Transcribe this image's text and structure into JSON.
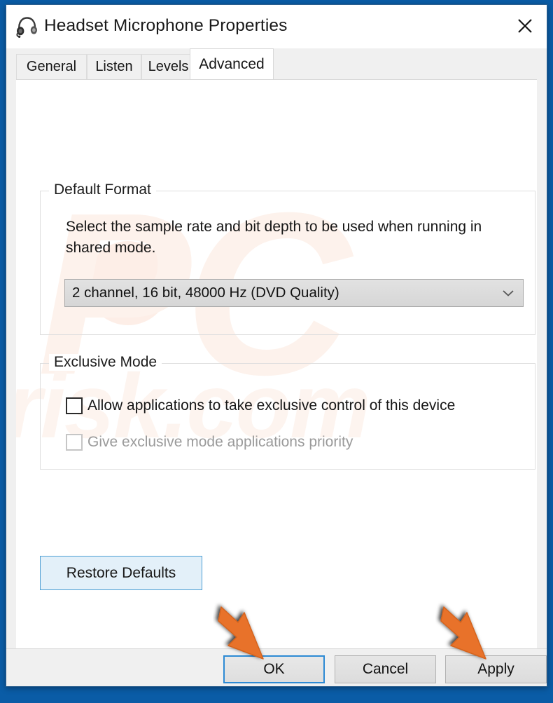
{
  "window": {
    "title": "Headset Microphone Properties",
    "icon": "headset-icon",
    "close_label": "✕"
  },
  "tabs": [
    {
      "label": "General",
      "active": false
    },
    {
      "label": "Listen",
      "active": false
    },
    {
      "label": "Levels",
      "active": false
    },
    {
      "label": "Advanced",
      "active": true
    }
  ],
  "default_format": {
    "group_title": "Default Format",
    "description": "Select the sample rate and bit depth to be used when running in shared mode.",
    "combo": {
      "value": "2 channel, 16 bit, 48000 Hz (DVD Quality)",
      "arrow_icon": "chevron-down-icon",
      "options": [
        "2 channel, 16 bit, 48000 Hz (DVD Quality)"
      ]
    }
  },
  "exclusive_mode": {
    "group_title": "Exclusive Mode",
    "checkboxes": [
      {
        "label": "Allow applications to take exclusive control of this device",
        "checked": false,
        "disabled": false
      },
      {
        "label": "Give exclusive mode applications priority",
        "checked": false,
        "disabled": true
      }
    ]
  },
  "restore_defaults": {
    "label": "Restore Defaults"
  },
  "footer": {
    "ok_label": "OK",
    "cancel_label": "Cancel",
    "apply_label": "Apply"
  },
  "annotations": [
    {
      "name": "arrow-pointing-to-ok",
      "target": "OK"
    },
    {
      "name": "arrow-pointing-to-apply",
      "target": "Apply"
    }
  ],
  "watermark": {
    "logo_text": "PC",
    "domain_text": "risk.com"
  },
  "colors": {
    "desktop_blue": "#0a5ca6",
    "accent_focus_blue": "#2d8ad4",
    "arrow_orange": "#e8722a",
    "titlebar_bg": "#ffffff",
    "content_bg": "#ffffff",
    "chrome_bg": "#f0f0f0"
  }
}
